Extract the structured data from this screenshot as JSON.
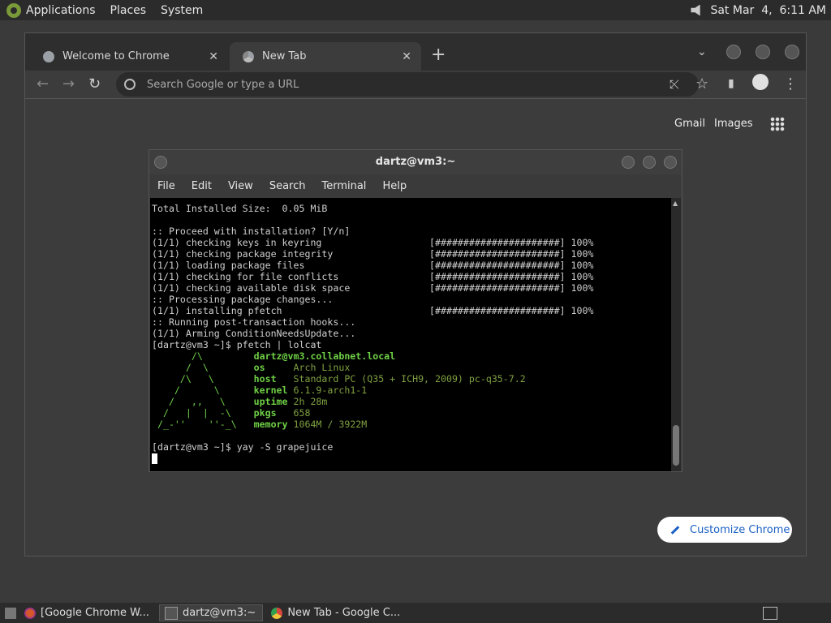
{
  "top_panel": {
    "menus": [
      "Applications",
      "Places",
      "System"
    ],
    "clock": "Sat Mar  4,  6:11 AM"
  },
  "chrome": {
    "tabs": [
      {
        "title": "Welcome to Chrome",
        "close": "✕"
      },
      {
        "title": "New Tab",
        "close": "✕"
      }
    ],
    "new_tab": "+",
    "tab_list": "⌄",
    "nav": {
      "back": "←",
      "forward": "→",
      "reload": "↻",
      "share": "⤪",
      "bookmark": "☆",
      "sidebar": "▮",
      "menu": "⋮"
    },
    "omnibox_placeholder": "Search Google or type a URL",
    "ntp": {
      "gmail": "Gmail",
      "images": "Images",
      "customize": "Customize Chrome"
    }
  },
  "terminal": {
    "title": "dartz@vm3:~",
    "menu": [
      "File",
      "Edit",
      "View",
      "Search",
      "Terminal",
      "Help"
    ],
    "lines_top": [
      "Total Installed Size:  0.05 MiB",
      "",
      ":: Proceed with installation? [Y/n]",
      "(1/1) checking keys in keyring                   [######################] 100%",
      "(1/1) checking package integrity                 [######################] 100%",
      "(1/1) loading package files                      [######################] 100%",
      "(1/1) checking for file conflicts                [######################] 100%",
      "(1/1) checking available disk space              [######################] 100%",
      ":: Processing package changes...",
      "(1/1) installing pfetch                          [######################] 100%",
      ":: Running post-transaction hooks...",
      "(1/1) Arming ConditionNeedsUpdate...",
      "[dartz@vm3 ~]$ pfetch | lolcat"
    ],
    "pfetch": {
      "art": [
        "       /\\",
        "      /  \\",
        "     /\\   \\",
        "    /      \\",
        "   /   ,,   \\",
        "  /   |  |  -\\",
        " /_-''    ''-_\\"
      ],
      "header": "dartz@vm3.collabnet.local",
      "fields": [
        {
          "key": "os",
          "value": "Arch Linux"
        },
        {
          "key": "host",
          "value": "Standard PC (Q35 + ICH9, 2009) pc-q35-7.2"
        },
        {
          "key": "kernel",
          "value": "6.1.9-arch1-1"
        },
        {
          "key": "uptime",
          "value": "2h 28m"
        },
        {
          "key": "pkgs",
          "value": "658"
        },
        {
          "key": "memory",
          "value": "1064M / 3922M"
        }
      ]
    },
    "prompt_line": "[dartz@vm3 ~]$ yay -S grapejuice"
  },
  "taskbar": {
    "tasks": [
      "[Google Chrome W...",
      "dartz@vm3:~",
      "New Tab - Google C..."
    ]
  }
}
